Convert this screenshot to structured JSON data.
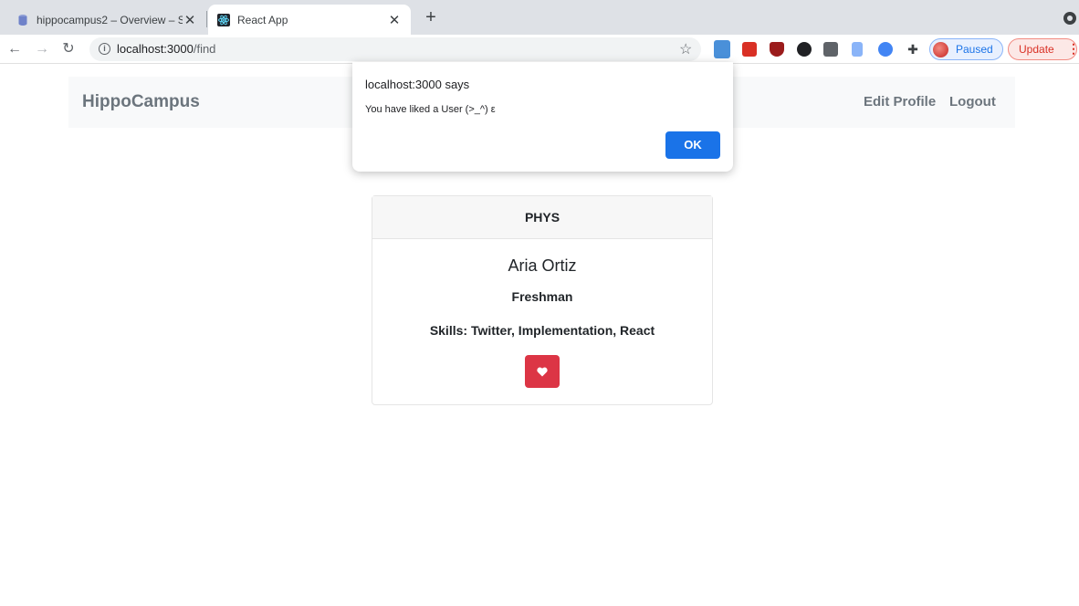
{
  "browser": {
    "tabs": [
      {
        "title": "hippocampus2 – Overview – S",
        "close": "✕"
      },
      {
        "title": "React App",
        "close": "✕"
      }
    ],
    "new_tab": "+",
    "url_host": "localhost:3000",
    "url_path": "/find",
    "profile_label": "Paused",
    "update_label": "Update"
  },
  "navbar": {
    "brand": "HippoCampus",
    "edit_profile": "Edit Profile",
    "logout": "Logout"
  },
  "alert": {
    "origin": "localhost:3000 says",
    "message": "You have liked a User (>_^) ε",
    "ok_label": "OK"
  },
  "card": {
    "header": "PHYS",
    "name": "Aria Ortiz",
    "year": "Freshman",
    "skills": "Skills: Twitter, Implementation, React",
    "like_icon": "heart-icon"
  },
  "colors": {
    "accent_blue": "#1a73e8",
    "like_red": "#dc3545",
    "navbar_bg": "#f8f9fa"
  }
}
